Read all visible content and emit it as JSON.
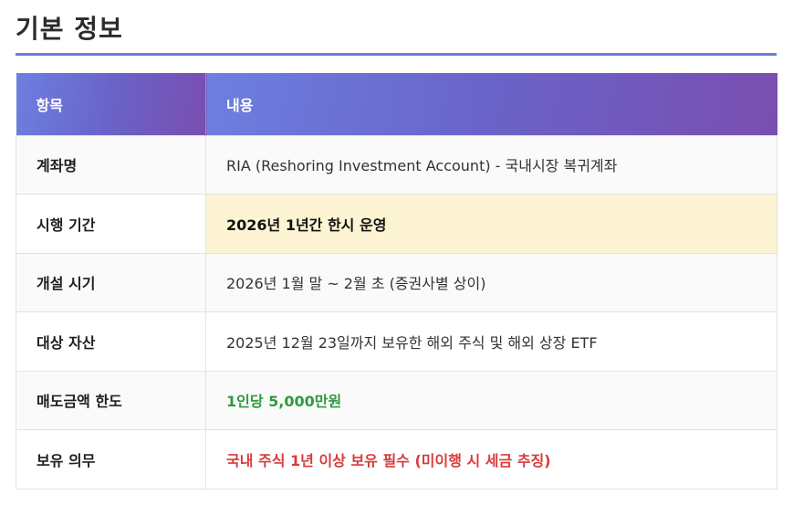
{
  "section": {
    "title": "기본 정보"
  },
  "table": {
    "headers": [
      "항목",
      "내용"
    ],
    "rows": [
      {
        "label": "계좌명",
        "value": "RIA (Reshoring Investment Account) - 국내시장 복귀계좌"
      },
      {
        "label": "시행 기간",
        "value": "2026년 1년간 한시 운영"
      },
      {
        "label": "개설 시기",
        "value": "2026년 1월 말 ~ 2월 초 (증권사별 상이)"
      },
      {
        "label": "대상 자산",
        "value": "2025년 12월 23일까지 보유한 해외 주식 및 해외 상장 ETF"
      },
      {
        "label": "매도금액 한도",
        "value": "1인당 5,000만원"
      },
      {
        "label": "보유 의무",
        "value": "국내 주식 1년 이상 보유 필수 (미이행 시 세금 추징)"
      }
    ]
  },
  "colors": {
    "accent_rule": "#6b7fd7",
    "header_gradient_start": "#6d7fe0",
    "header_gradient_end": "#7a4eb0",
    "highlight_bg": "#fdf4d3",
    "green_text": "#2e9a3e",
    "red_text": "#d93b3b"
  }
}
